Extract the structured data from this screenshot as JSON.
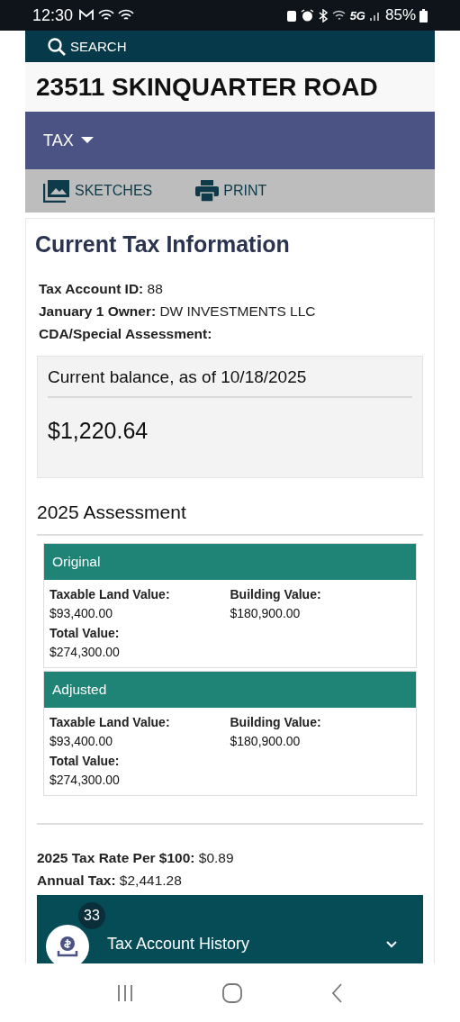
{
  "status_bar": {
    "time": "12:30",
    "network": "5G",
    "battery": "85%"
  },
  "search": {
    "label": "SEARCH"
  },
  "title": "23511 SKINQUARTER ROAD",
  "section_menu": {
    "label": "TAX"
  },
  "toolbar": [
    {
      "label": "SKETCHES",
      "kind": "sketches"
    },
    {
      "label": "PRINT",
      "kind": "print"
    }
  ],
  "heading": "Current Tax Information",
  "info": [
    {
      "label": "Tax Account ID:",
      "value": "88"
    },
    {
      "label": "January 1 Owner:",
      "value": "DW INVESTMENTS LLC"
    },
    {
      "label": "CDA/Special Assessment:"
    }
  ],
  "balance": {
    "label": "Current balance, as of 10/18/2025",
    "amount": "$1,220.64"
  },
  "assessment": {
    "title": "2025 Assessment",
    "panels": [
      {
        "title": "Original",
        "fields": [
          {
            "label": "Taxable Land Value:",
            "value": "$93,400.00"
          },
          {
            "label": "Building Value:",
            "value": "$180,900.00"
          },
          {
            "label": "Total Value:",
            "value": "$274,300.00"
          }
        ]
      },
      {
        "title": "Adjusted",
        "fields": [
          {
            "label": "Taxable Land Value:",
            "value": "$93,400.00"
          },
          {
            "label": "Building Value:",
            "value": "$180,900.00"
          },
          {
            "label": "Total Value:",
            "value": "$274,300.00"
          }
        ]
      }
    ]
  },
  "summary": [
    {
      "label": "2025 Tax Rate Per $100:",
      "value": "$0.89"
    },
    {
      "label": "Annual Tax:",
      "value": "$2,441.28"
    }
  ],
  "history": {
    "title": "Tax Account History",
    "badge": "33"
  }
}
